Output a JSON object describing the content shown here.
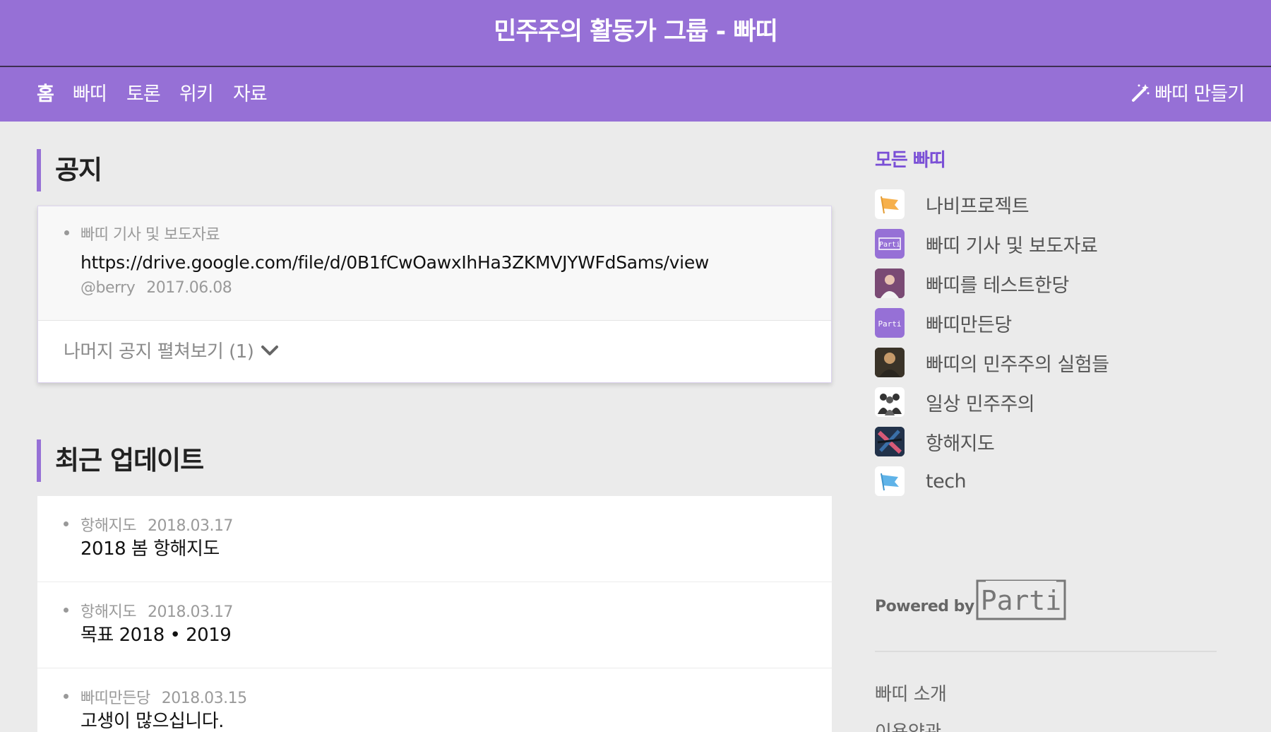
{
  "header": {
    "title": "민주주의 활동가 그룹 - 빠띠"
  },
  "nav": {
    "items": [
      {
        "label": "홈"
      },
      {
        "label": "빠띠"
      },
      {
        "label": "토론"
      },
      {
        "label": "위키"
      },
      {
        "label": "자료"
      }
    ],
    "make_label": "빠띠 만들기",
    "make_icon": "magic-wand-icon"
  },
  "notice": {
    "heading": "공지",
    "item": {
      "group": "빠띠 기사 및 보도자료",
      "url": "https://drive.google.com/file/d/0B1fCwOawxIhHa3ZKMVJYWFdSams/view",
      "author": "@berry",
      "date": "2017.06.08"
    },
    "expand_label": "나머지 공지 펼쳐보기 (1)",
    "expand_icon": "chevron-down-icon"
  },
  "updates": {
    "heading": "최근 업데이트",
    "items": [
      {
        "group": "항해지도",
        "date": "2018.03.17",
        "title": "2018 봄 항해지도"
      },
      {
        "group": "항해지도",
        "date": "2018.03.17",
        "title": "목표 2018 • 2019"
      },
      {
        "group": "빠띠만든당",
        "date": "2018.03.15",
        "title": "고생이 많으십니다."
      }
    ]
  },
  "sidebar": {
    "title": "모든 빠띠",
    "items": [
      {
        "label": "나비프로젝트",
        "icon": "flag-orange-icon"
      },
      {
        "label": "빠띠 기사 및 보도자료",
        "icon": "parti-logo-icon"
      },
      {
        "label": "빠띠를 테스트한당",
        "icon": "person-photo-icon"
      },
      {
        "label": "빠띠만든당",
        "icon": "parti-logo-icon"
      },
      {
        "label": "빠띠의 민주주의 실험들",
        "icon": "person-photo-icon"
      },
      {
        "label": "일상 민주주의",
        "icon": "people-photo-icon"
      },
      {
        "label": "항해지도",
        "icon": "map-photo-icon"
      },
      {
        "label": "tech",
        "icon": "flag-blue-icon"
      }
    ],
    "parti_logo_text": "Parti",
    "powered_by": "Powered by",
    "links": [
      {
        "label": "빠띠 소개"
      },
      {
        "label": "이용약관"
      }
    ]
  },
  "colors": {
    "brand": "#9670d6",
    "accent_text": "#7a4fd6",
    "background": "#ebebeb"
  }
}
